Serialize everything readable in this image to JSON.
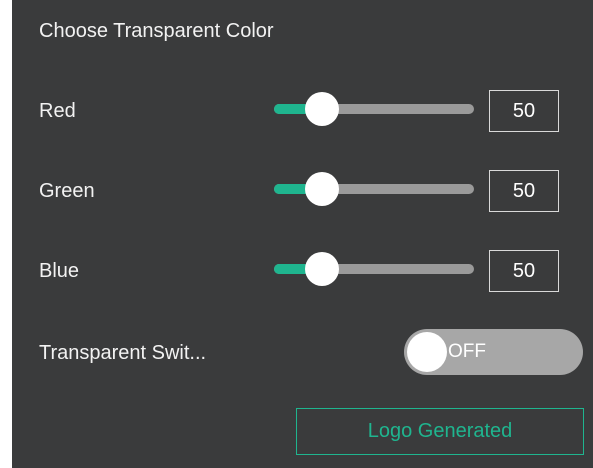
{
  "panel": {
    "title": "Choose Transparent Color"
  },
  "colors": {
    "accent": "#1fb58f",
    "background": "#3a3b3c",
    "track": "#9a9a9a",
    "toggle_off": "#a7a7a7"
  },
  "sliders": [
    {
      "label": "Red",
      "value": "50",
      "level_percent": 24
    },
    {
      "label": "Green",
      "value": "50",
      "level_percent": 24
    },
    {
      "label": "Blue",
      "value": "50",
      "level_percent": 24
    }
  ],
  "toggle": {
    "label": "Transparent Swit...",
    "state_text": "OFF"
  },
  "actions": {
    "logo_generated_label": "Logo Generated"
  }
}
